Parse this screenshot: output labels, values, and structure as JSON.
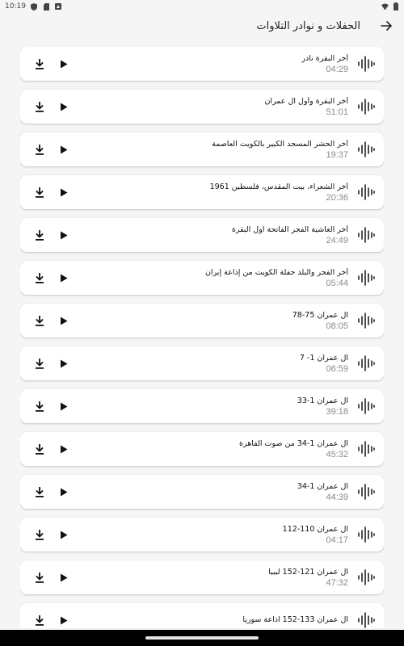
{
  "status_bar": {
    "time": "10:19",
    "icons": [
      "shield-icon",
      "sd-card-icon",
      "notification-icon",
      "wifi-icon",
      "battery-icon"
    ]
  },
  "app_bar": {
    "title": "الحفلات و نوادر التلاوات",
    "back_icon": "arrow-back-icon"
  },
  "tracks": [
    {
      "title": "أخر البقرة نادر",
      "duration": "04:29"
    },
    {
      "title": "أخر البقرة وأول آل عمران",
      "duration": "51:01"
    },
    {
      "title": "أخر الحشر المسجد الكبير بالكويت العاصمة",
      "duration": "19:37"
    },
    {
      "title": "أخر الشعراء، بيت المقدس، فلسطين 1961",
      "duration": "20:36"
    },
    {
      "title": "أخر الغاشية الفجر الفاتحة اول البقرة",
      "duration": "24:49"
    },
    {
      "title": "أخر الفجر والبلد حفلة الكويت من إذاعة إيران",
      "duration": "05:44"
    },
    {
      "title": "آل عمران 75-78",
      "duration": "08:05"
    },
    {
      "title": "آل عمران 1- 7",
      "duration": "06:59"
    },
    {
      "title": "آل عمران 1-33",
      "duration": "39:18"
    },
    {
      "title": "آل عمران 1-34 من صوت القاهرة",
      "duration": "45:32"
    },
    {
      "title": "آل عمران 1-34",
      "duration": "44:39"
    },
    {
      "title": "آل عمران 110-112",
      "duration": "04:17"
    },
    {
      "title": "آل عمران 121-152 ليبيا",
      "duration": "47:32"
    },
    {
      "title": "آل عمران 133-152 اذاعة سوريا",
      "duration": ""
    }
  ],
  "icons": {
    "wave": "sound-wave-icon",
    "play": "play-icon",
    "download": "download-icon"
  }
}
